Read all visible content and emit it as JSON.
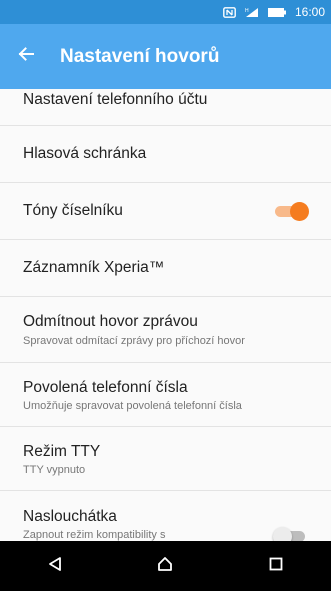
{
  "status_bar": {
    "time": "16:00",
    "icons": [
      "nfc-icon",
      "signal-icon",
      "battery-icon"
    ]
  },
  "toolbar": {
    "title": "Nastavení hovorů",
    "back_icon": "back-arrow-icon"
  },
  "settings": [
    {
      "title": "Nastavení telefonního účtu"
    },
    {
      "title": "Hlasová schránka"
    },
    {
      "title": "Tóny číselníku",
      "toggle": true
    },
    {
      "title": "Záznamník Xperia™"
    },
    {
      "title": "Odmítnout hovor zprávou",
      "subtitle": "Spravovat odmítací zprávy pro příchozí hovor"
    },
    {
      "title": "Povolená telefonní čísla",
      "subtitle": "Umožňuje spravovat povolená telefonní čísla"
    },
    {
      "title": "Režim TTY",
      "subtitle": "TTY vypnuto"
    },
    {
      "title": "Naslouchátka",
      "subtitle": "Zapnout režim kompatibility s",
      "toggle": false
    }
  ],
  "nav_bar": {
    "buttons": [
      "back-icon",
      "home-icon",
      "recents-icon"
    ]
  },
  "colors": {
    "status_bar": "#2e8fd6",
    "toolbar": "#4fa8ee",
    "toggle_on": "#f57c1f",
    "toggle_on_track": "#f8b98a",
    "toggle_off_thumb": "#ececec",
    "toggle_off_track": "#bdbdbd"
  }
}
